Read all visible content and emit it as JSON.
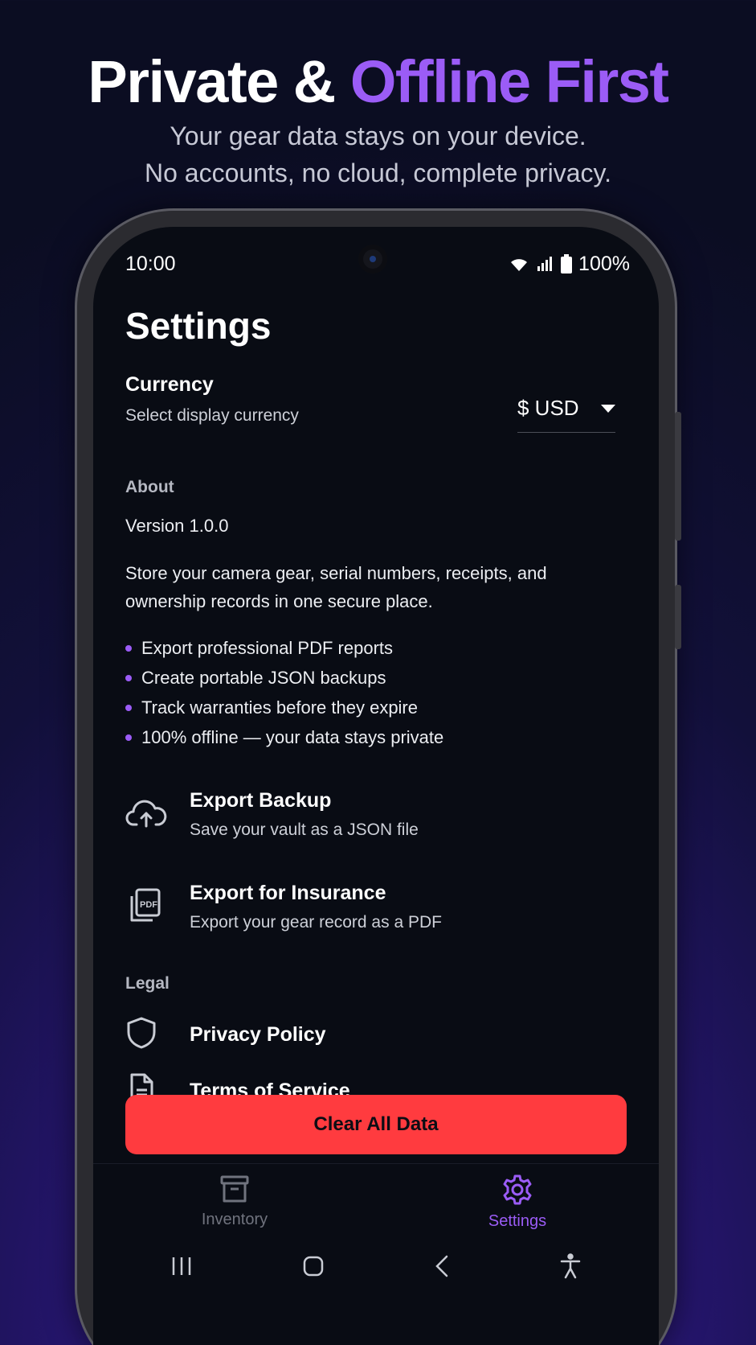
{
  "hero": {
    "title_main": "Private & ",
    "title_accent": "Offline First",
    "subtitle_line1": "Your gear data stays on your device.",
    "subtitle_line2": "No accounts, no cloud, complete privacy."
  },
  "status_bar": {
    "time": "10:00",
    "battery": "100%",
    "icons": [
      "wifi-icon",
      "signal-icon",
      "battery-icon"
    ]
  },
  "settings": {
    "title": "Settings",
    "currency": {
      "label": "Currency",
      "description": "Select display currency",
      "selected": "$ USD"
    },
    "about": {
      "section_label": "About",
      "version": "Version 1.0.0",
      "description": "Store your camera gear, serial numbers, receipts, and ownership records in one secure place.",
      "features": [
        "Export professional PDF reports",
        "Create portable JSON backups",
        "Track warranties before they expire",
        "100% offline — your data stays private"
      ]
    },
    "actions": [
      {
        "icon": "cloud-upload-icon",
        "title": "Export Backup",
        "subtitle": "Save your vault as a JSON file"
      },
      {
        "icon": "pdf-icon",
        "title": "Export for Insurance",
        "subtitle": "Export your gear record as a PDF"
      }
    ],
    "legal": {
      "section_label": "Legal",
      "items": [
        {
          "icon": "shield-icon",
          "label": "Privacy Policy"
        },
        {
          "icon": "document-icon",
          "label": "Terms of Service"
        }
      ]
    },
    "clear_button": "Clear All Data"
  },
  "tabs": [
    {
      "icon": "archive-icon",
      "label": "Inventory",
      "active": false
    },
    {
      "icon": "gear-icon",
      "label": "Settings",
      "active": true
    }
  ],
  "system_nav": [
    "recents-icon",
    "home-icon",
    "back-icon",
    "accessibility-icon"
  ],
  "colors": {
    "accent": "#9b5cf6",
    "danger": "#ff3b3f",
    "screen_bg": "#090c14"
  }
}
